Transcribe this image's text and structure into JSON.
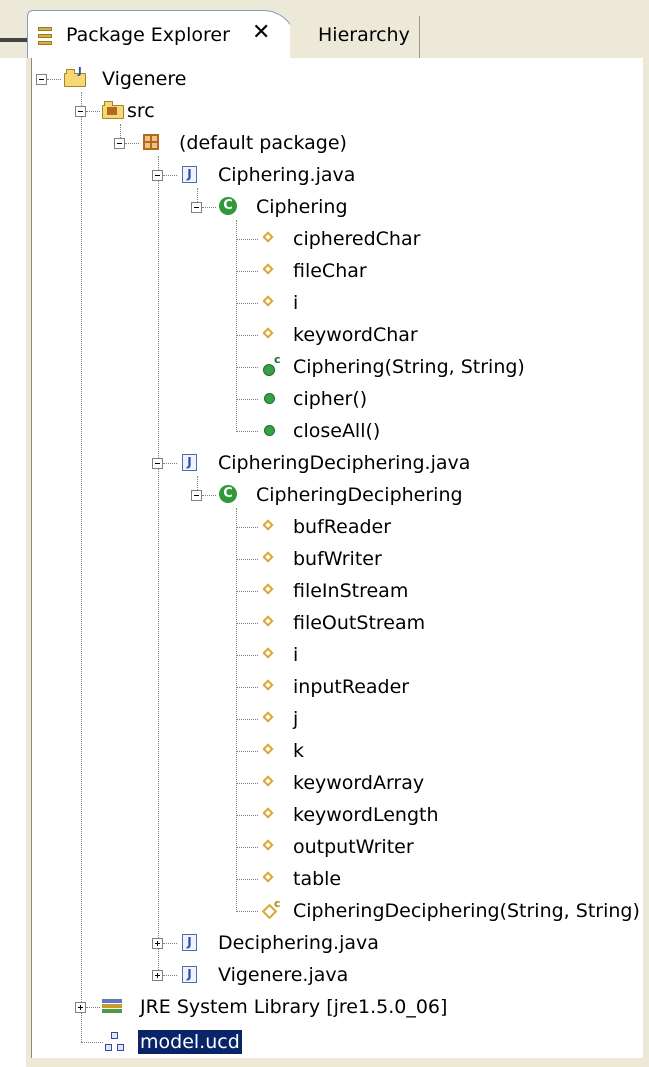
{
  "tabs": {
    "package_explorer": "Package Explorer",
    "close": "✕",
    "hierarchy": "Hierarchy"
  },
  "tree": {
    "project": "Vigenere",
    "src": "src",
    "package": "(default package)",
    "file1": {
      "name": "Ciphering.java",
      "class": "Ciphering",
      "fields": [
        "cipheredChar",
        "fileChar",
        "i",
        "keywordChar"
      ],
      "constructor": "Ciphering(String, String)",
      "methods": [
        "cipher()",
        "closeAll()"
      ]
    },
    "file2": {
      "name": "CipheringDeciphering.java",
      "class": "CipheringDeciphering",
      "fields": [
        "bufReader",
        "bufWriter",
        "fileInStream",
        "fileOutStream",
        "i",
        "inputReader",
        "j",
        "k",
        "keywordArray",
        "keywordLength",
        "outputWriter",
        "table"
      ],
      "constructor": "CipheringDeciphering(String, String)"
    },
    "file3": "Deciphering.java",
    "file4": "Vigenere.java",
    "jre": "JRE System Library [jre1.5.0_06]",
    "model": "model.ucd"
  },
  "icons": {
    "project": "java-project-icon",
    "folder": "source-folder-icon",
    "package": "package-icon",
    "java_file": "java-file-icon",
    "class": "class-icon",
    "field": "field-icon",
    "method": "method-icon",
    "constructor": "constructor-icon",
    "library": "library-icon",
    "ucd": "uml-diagram-icon"
  },
  "colors": {
    "selection": "#0a246a",
    "frame": "#ece9d8",
    "method": "#3aa048",
    "field": "#d8a830"
  }
}
